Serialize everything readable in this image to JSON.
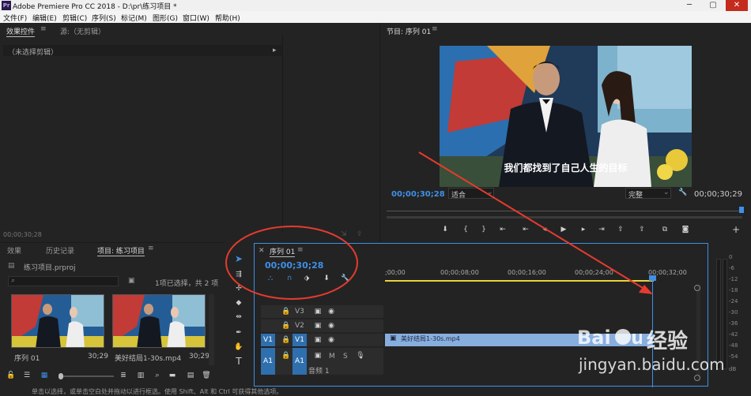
{
  "app": {
    "window_title": "Adobe Premiere Pro CC 2018 - D:\\pr\\练习项目 *",
    "logo_text": "Pr"
  },
  "menu": [
    "文件(F)",
    "编辑(E)",
    "剪辑(C)",
    "序列(S)",
    "标记(M)",
    "图形(G)",
    "窗口(W)",
    "帮助(H)"
  ],
  "source_panel": {
    "tab_effect_controls": "效果控件",
    "tab_source": "源:（无剪辑）",
    "no_clip": "（未选择剪辑）",
    "timecode": "00;00;30;28"
  },
  "program_monitor": {
    "title": "节目: 序列 01",
    "subtitle": "我们都找到了自己人生的目标",
    "timecode_current": "00;00;30;28",
    "fit": "适合",
    "quality": "完整",
    "timecode_duration": "00;00;30;29"
  },
  "project_panel": {
    "tab_effects": "效果",
    "tab_history": "历史记录",
    "tab_project": "项目: 练习项目",
    "file_name": "练习项目.prproj",
    "selection_info": "1项已选择，共 2 项",
    "items": [
      {
        "name": "序列 01",
        "duration": "30;29"
      },
      {
        "name": "美好结局1-30s.mp4",
        "duration": "30;29"
      }
    ]
  },
  "timeline": {
    "tab_label": "序列 01",
    "timecode": "00;00;30;28",
    "ruler": [
      ";00;00",
      "00;00;08;00",
      "00;00;16;00",
      "00;00;24;00",
      "00;00;32;00"
    ],
    "tracks": [
      {
        "name": "V3",
        "target": ""
      },
      {
        "name": "V2",
        "target": ""
      },
      {
        "name": "V1",
        "target": "V1"
      },
      {
        "name": "A1",
        "target": "A1",
        "label": "音频 1"
      }
    ],
    "clip_name": "美好结局1-30s.mp4"
  },
  "audio_meter": {
    "levels": [
      "0",
      "-6",
      "-12",
      "-18",
      "-24",
      "-30",
      "-36",
      "-42",
      "-48",
      "-54",
      "dB"
    ]
  },
  "status_bar": "单击以选择，或单击空白处并拖动以进行框选。使用 Shift、Alt 和 Ctrl 可获得其他选项。",
  "watermark": {
    "brand_cn": "经验",
    "url": "jingyan.baidu.com"
  },
  "colors": {
    "accent_blue": "#3f8fe6",
    "annotation_red": "#e53b2f",
    "clip_blue": "#88aede",
    "playhead": "#3f8fe6"
  }
}
